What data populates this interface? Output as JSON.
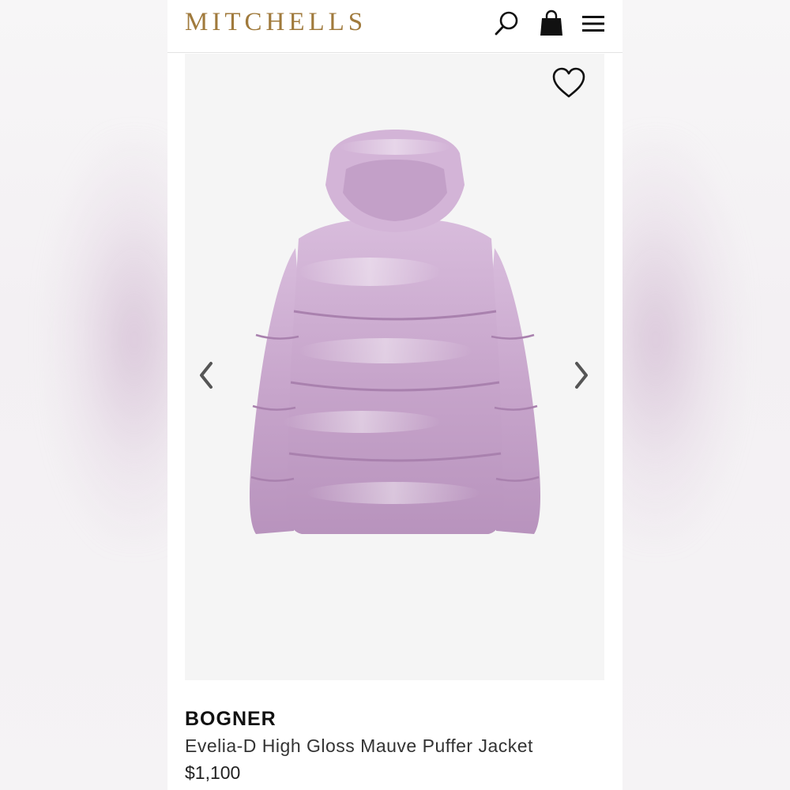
{
  "header": {
    "logo_text": "MITCHELLS",
    "icons": [
      "search-icon",
      "shopping-bag-icon",
      "hamburger-menu-icon"
    ]
  },
  "gallery": {
    "icons": [
      "heart-icon",
      "chevron-left-icon",
      "chevron-right-icon"
    ],
    "image_subject": "mauve puffer jacket back view"
  },
  "product": {
    "brand": "BOGNER",
    "name": "Evelia-D High Gloss Mauve Puffer Jacket",
    "price": "$1,100"
  },
  "colors": {
    "logo_gold": "#a07a3c",
    "jacket_mauve": "#c9a8cc",
    "gallery_bg": "#f5f5f5"
  }
}
